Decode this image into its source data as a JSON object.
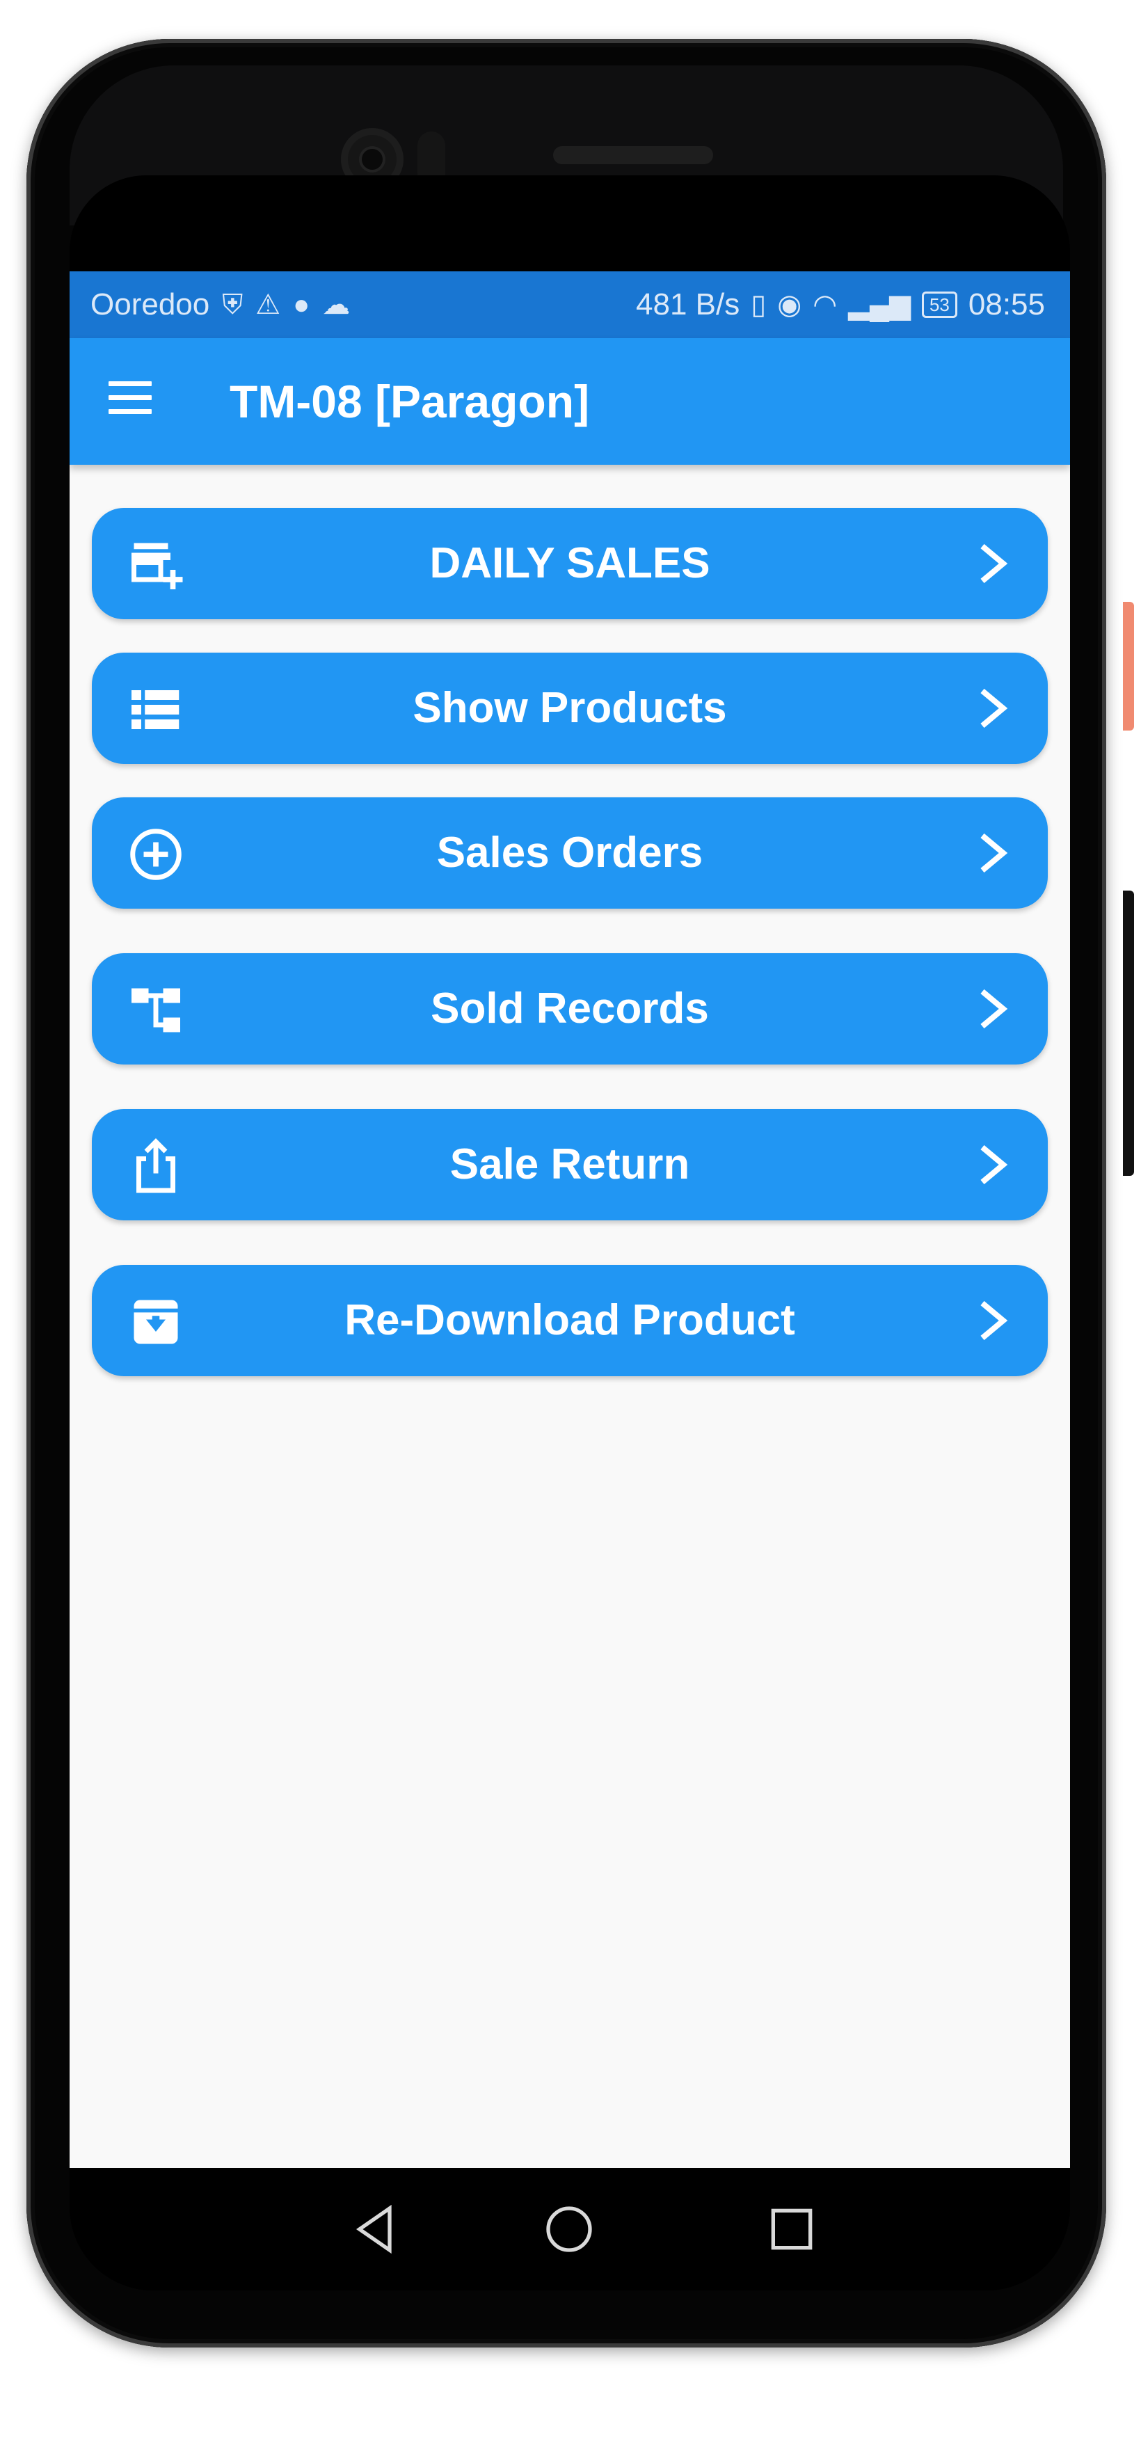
{
  "status_bar": {
    "carrier": "Ooredoo",
    "net_speed": "481 B/s",
    "battery": "53",
    "time": "08:55"
  },
  "app_bar": {
    "title": "TM-08 [Paragon]"
  },
  "menu": [
    {
      "label": "DAILY SALES",
      "icon": "store-add-icon"
    },
    {
      "label": "Show Products",
      "icon": "list-icon"
    },
    {
      "label": "Sales Orders",
      "icon": "add-circle-icon"
    },
    {
      "label": "Sold Records",
      "icon": "account-tree-icon"
    },
    {
      "label": "Sale Return",
      "icon": "share-upload-icon"
    },
    {
      "label": "Re-Download Product",
      "icon": "archive-download-icon"
    }
  ],
  "colors": {
    "primary": "#2196F3",
    "status_bar": "#1976D2",
    "background": "#f9f9f9"
  }
}
